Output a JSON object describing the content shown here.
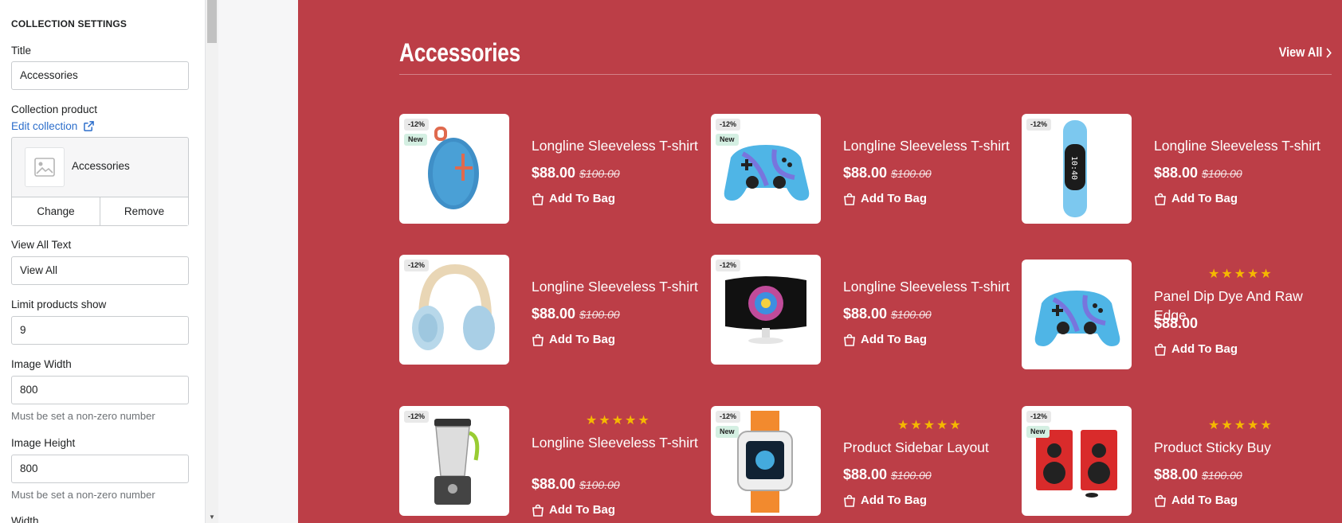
{
  "settings": {
    "section_title": "COLLECTION SETTINGS",
    "title_label": "Title",
    "title_value": "Accessories",
    "collection_label": "Collection product",
    "edit_collection": "Edit collection",
    "collection_name": "Accessories",
    "change_label": "Change",
    "remove_label": "Remove",
    "view_all_label": "View All Text",
    "view_all_value": "View All",
    "limit_label": "Limit products show",
    "limit_value": "9",
    "image_width_label": "Image Width",
    "image_width_value": "800",
    "image_width_help": "Must be set a non-zero number",
    "image_height_label": "Image Height",
    "image_height_value": "800",
    "image_height_help": "Must be set a non-zero number",
    "width_label": "Width"
  },
  "preview": {
    "bg_color": "#bc3e47",
    "section_title": "Accessories",
    "view_all": "View All",
    "add_to_bag": "Add To Bag",
    "stars": "★★★★★",
    "products": [
      {
        "name": "Longline Sleeveless T-shirt",
        "price": "$88.00",
        "compare": "$100.00",
        "sale": "-12%",
        "new": "New",
        "stars": false,
        "icon": "speaker-icon"
      },
      {
        "name": "Longline Sleeveless T-shirt",
        "price": "$88.00",
        "compare": "$100.00",
        "sale": "-12%",
        "new": "New",
        "stars": false,
        "icon": "gamepad-icon"
      },
      {
        "name": "Longline Sleeveless T-shirt",
        "price": "$88.00",
        "compare": "$100.00",
        "sale": "-12%",
        "new": "",
        "stars": false,
        "icon": "watch-icon"
      },
      {
        "name": "Longline Sleeveless T-shirt",
        "price": "$88.00",
        "compare": "$100.00",
        "sale": "-12%",
        "new": "",
        "stars": false,
        "icon": "headphones-icon"
      },
      {
        "name": "Longline Sleeveless T-shirt",
        "price": "$88.00",
        "compare": "$100.00",
        "sale": "-12%",
        "new": "",
        "stars": false,
        "icon": "monitor-icon"
      },
      {
        "name": "Panel Dip Dye And Raw Edge",
        "price": "$88.00",
        "compare": "",
        "sale": "",
        "new": "",
        "stars": true,
        "icon": "gamepad-icon"
      },
      {
        "name": "Longline Sleeveless T-shirt",
        "price": "$88.00",
        "compare": "$100.00",
        "sale": "-12%",
        "new": "",
        "stars": true,
        "icon": "blender-icon"
      },
      {
        "name": "Product Sidebar Layout",
        "price": "$88.00",
        "compare": "$100.00",
        "sale": "-12%",
        "new": "New",
        "stars": true,
        "icon": "kids-watch-icon"
      },
      {
        "name": "Product Sticky Buy",
        "price": "$88.00",
        "compare": "$100.00",
        "sale": "-12%",
        "new": "New",
        "stars": true,
        "icon": "speakers-icon"
      }
    ]
  }
}
